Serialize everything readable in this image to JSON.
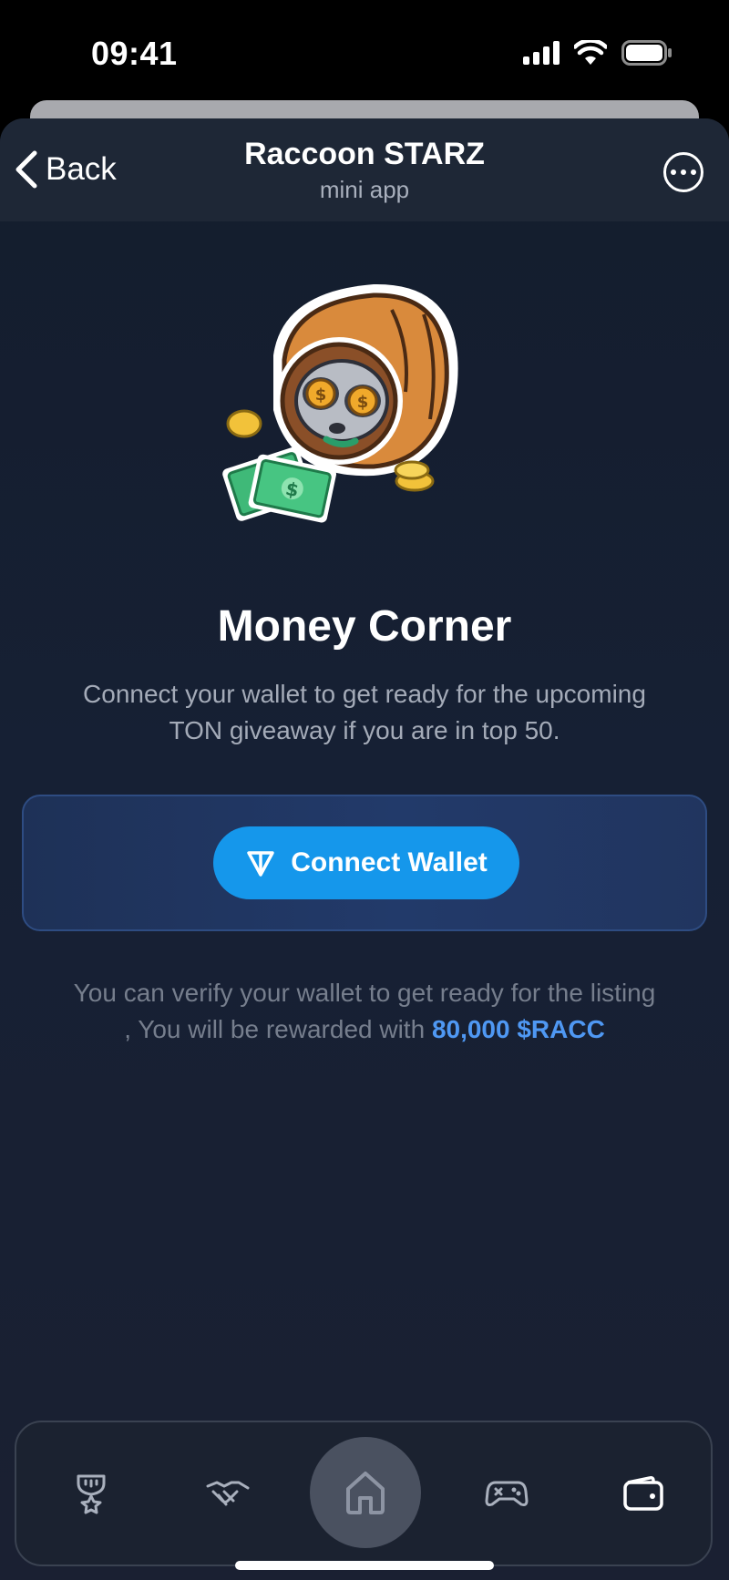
{
  "status_bar": {
    "time": "09:41"
  },
  "header": {
    "back_label": "Back",
    "title": "Raccoon STARZ",
    "subtitle": "mini app"
  },
  "main": {
    "title": "Money Corner",
    "description": "Connect your wallet to get ready for the upcoming TON giveaway if you are in top 50.",
    "connect_button_label": "Connect Wallet",
    "note_text": "You can verify your wallet to get ready for the listing , You will be rewarded with ",
    "note_highlight": "80,000 $RACC"
  },
  "bottom_nav": {
    "items": [
      {
        "icon": "trophy-icon",
        "active": false
      },
      {
        "icon": "handshake-icon",
        "active": false
      },
      {
        "icon": "home-icon",
        "active": true
      },
      {
        "icon": "gamepad-icon",
        "active": false
      },
      {
        "icon": "wallet-icon",
        "active": false
      }
    ]
  },
  "colors": {
    "accent": "#1597eb",
    "highlight": "#4f98f3",
    "background": "#162034"
  }
}
